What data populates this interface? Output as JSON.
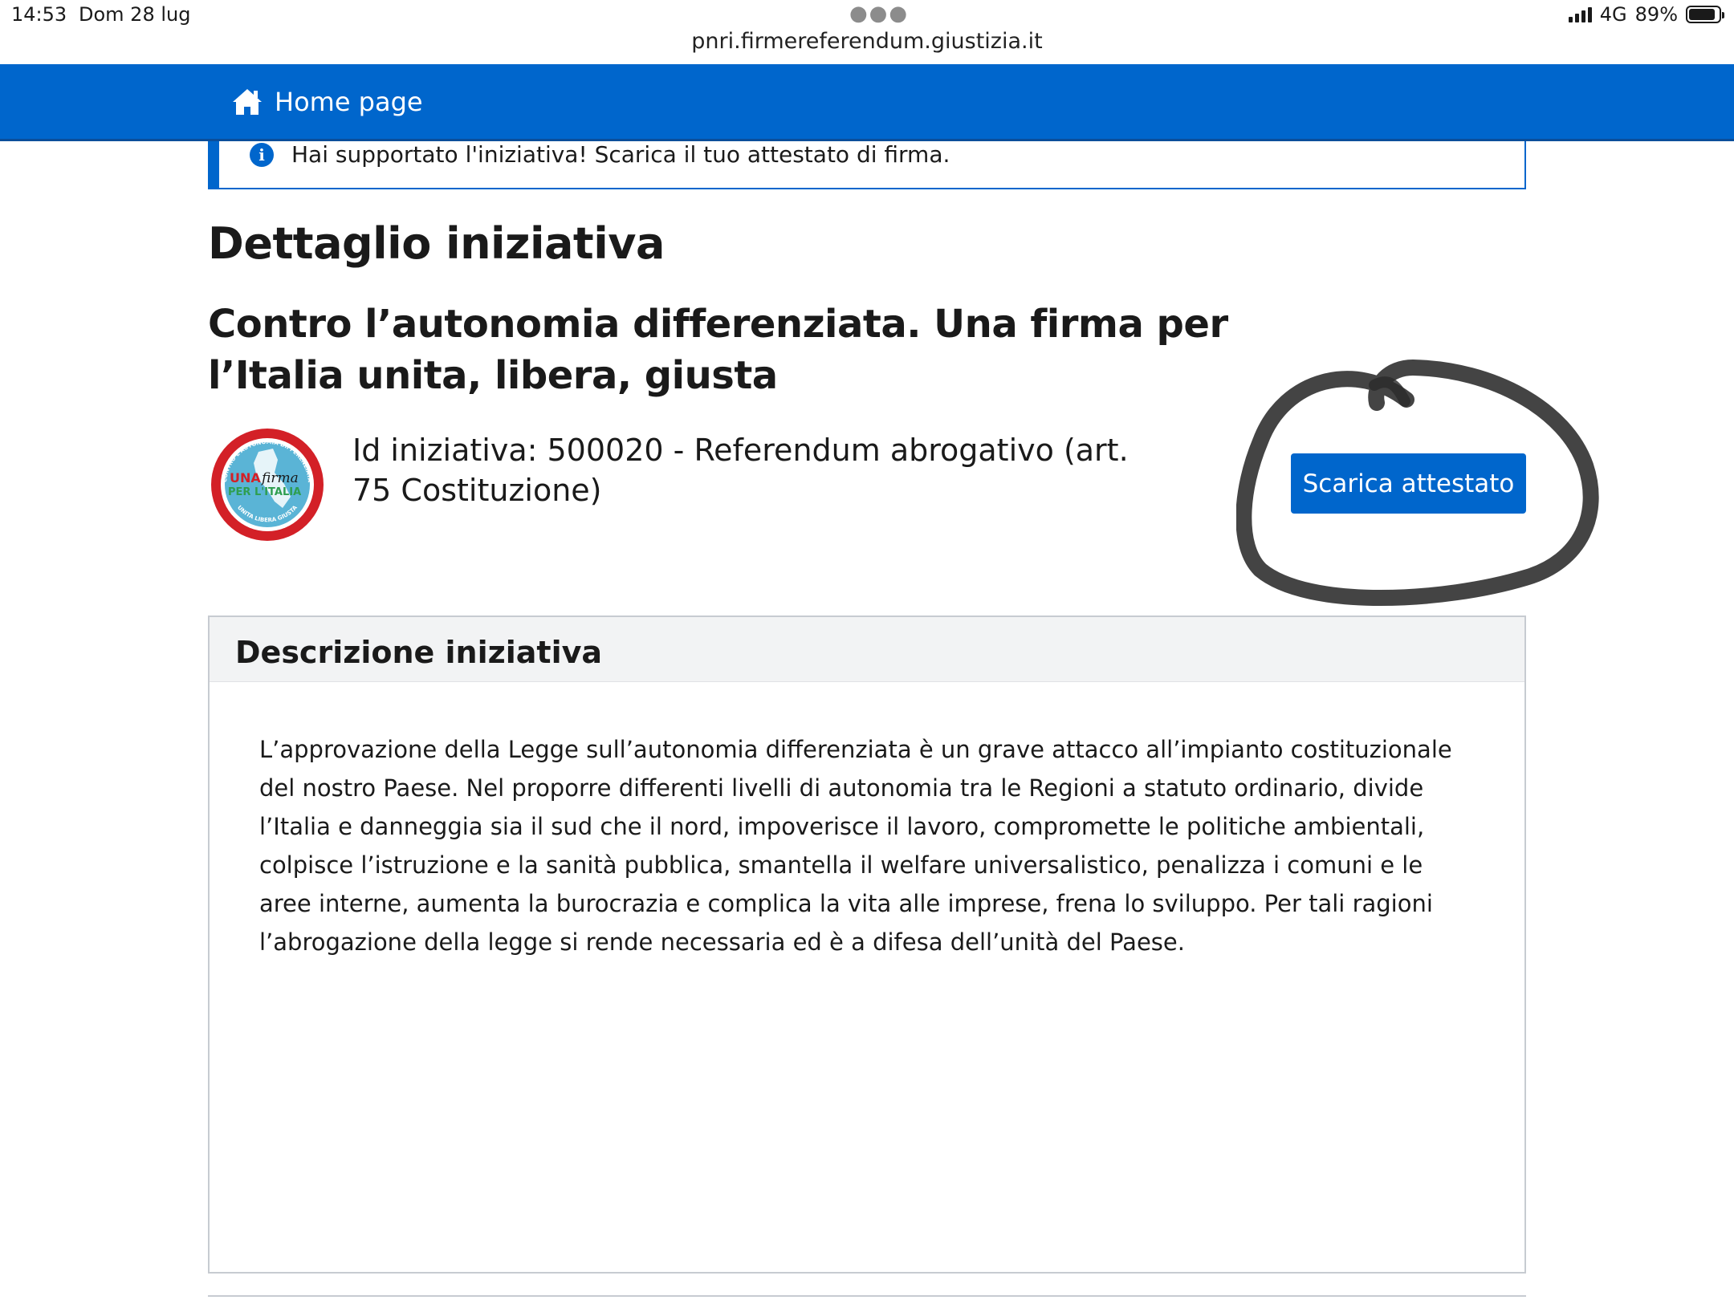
{
  "status_bar": {
    "time": "14:53",
    "date": "Dom 28 lug",
    "network": "4G",
    "battery": "89%",
    "battery_level": 0.89
  },
  "browser": {
    "url": "pnri.firmereferendum.giustizia.it"
  },
  "header": {
    "home_label": "Home page",
    "home_icon": "home-icon"
  },
  "alert": {
    "icon": "info-icon",
    "text": "Hai supportato l'iniziativa! Scarica il tuo attestato di firma."
  },
  "page": {
    "title": "Dettaglio iniziativa",
    "initiative_title": "Contro l’autonomia differenziata. Una firma per l’Italia unita, libera, giusta",
    "initiative_id": "Id iniziativa: 500020 - Referendum abrogativo (art. 75 Costituzione)",
    "download_button": "Scarica attestato"
  },
  "logo": {
    "ring_text_top": "CONTRO L'AUTONOMIA DIFFERENZIATA",
    "ring_text_bottom": "UNITA LIBERA GIUSTA",
    "line1_a": "UNA",
    "line1_b": "firma",
    "line2": "PER L'ITALIA"
  },
  "description": {
    "title": "Descrizione iniziativa",
    "text": "L’approvazione della Legge sull’autonomia differenziata è un grave attacco all’impianto costituzionale del nostro Paese. Nel proporre differenti livelli di autonomia tra le Regioni a statuto ordinario, divide l’Italia e danneggia sia il sud che il nord, impoverisce il lavoro, compromette le politiche ambientali, colpisce l’istruzione e la sanità pubblica, smantella il welfare universalistico, penalizza i comuni e le aree interne, aumenta la burocrazia e complica la vita alle imprese, frena lo sviluppo. Per tali ragioni l’abrogazione della legge si rende necessaria ed è a difesa dell’unità del Paese."
  },
  "colors": {
    "primary": "#0066cc",
    "logo_red": "#d32027",
    "logo_blue": "#5ab4d6",
    "logo_green": "#2e9e4f"
  }
}
